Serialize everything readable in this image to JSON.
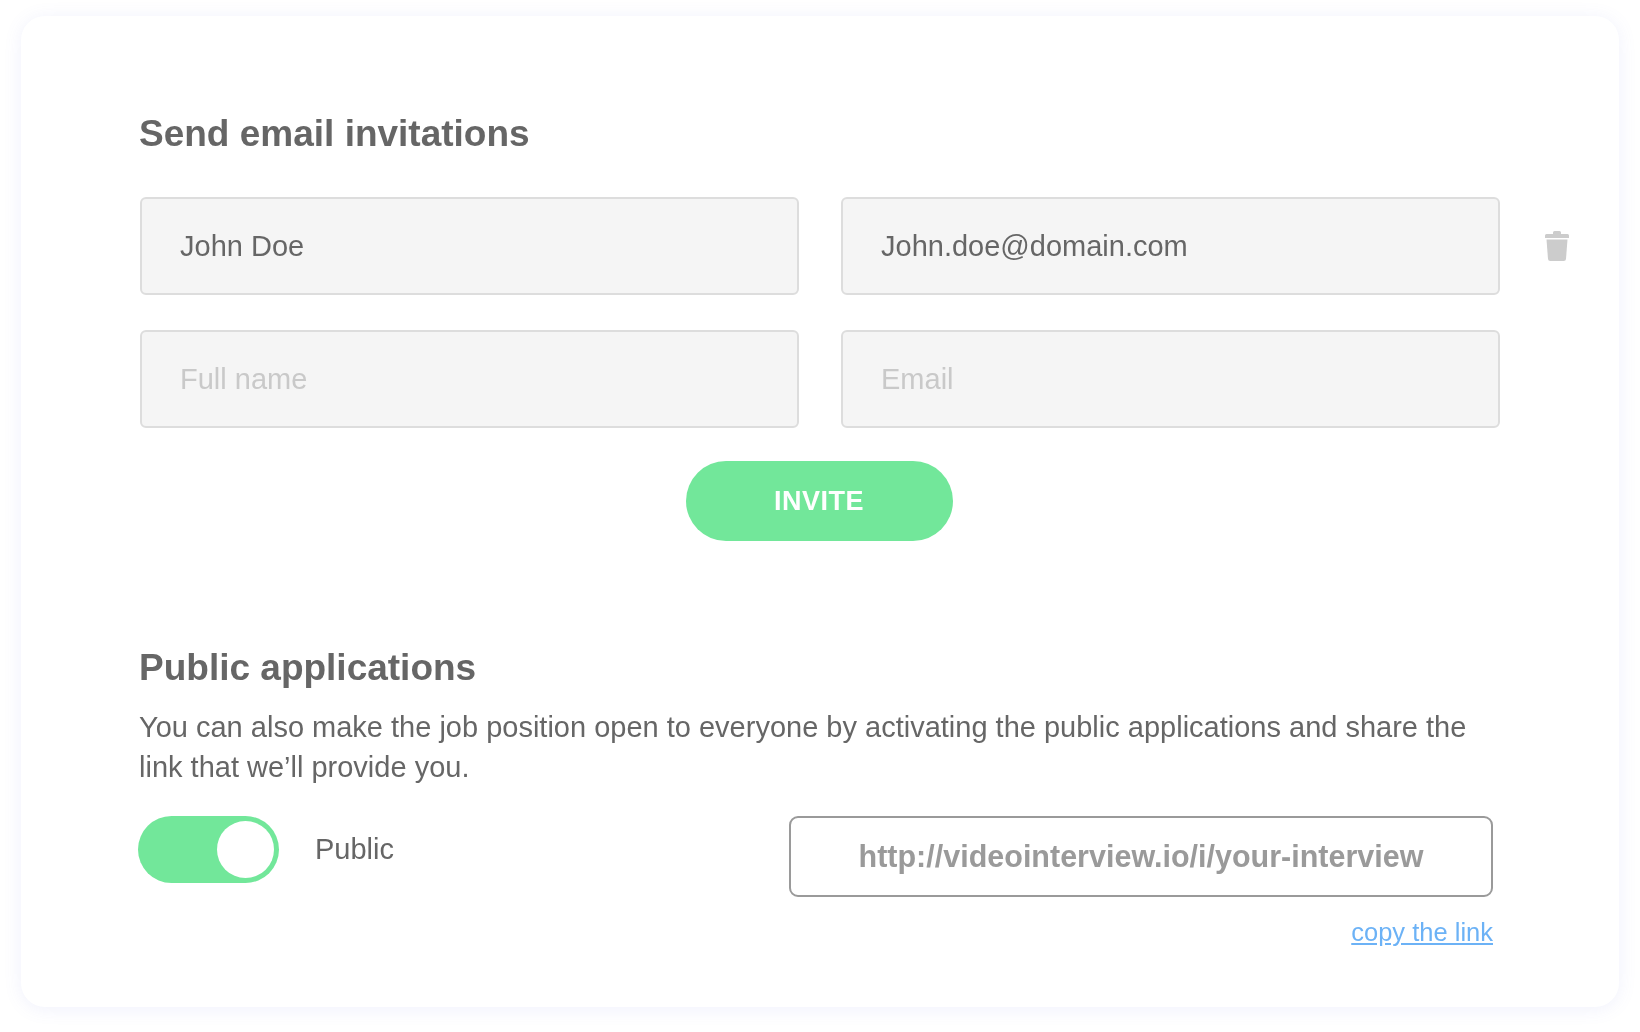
{
  "invitations": {
    "title": "Send email invitations",
    "rows": [
      {
        "name": {
          "value": "John Doe"
        },
        "email": {
          "value": "John.doe@domain.com"
        },
        "removable": true
      },
      {
        "name": {
          "placeholder": "Full name"
        },
        "email": {
          "placeholder": "Email"
        },
        "removable": false
      }
    ],
    "invite_button": "INVITE"
  },
  "public_applications": {
    "title": "Public applications",
    "description": "You can also make the job position open to everyone by activating the public applications and share the link that we’ll provide you.",
    "toggle": {
      "label": "Public",
      "on": true
    },
    "link": {
      "value": "http://videointerview.io/i/your-interview"
    },
    "copy_link": "copy the link"
  }
}
